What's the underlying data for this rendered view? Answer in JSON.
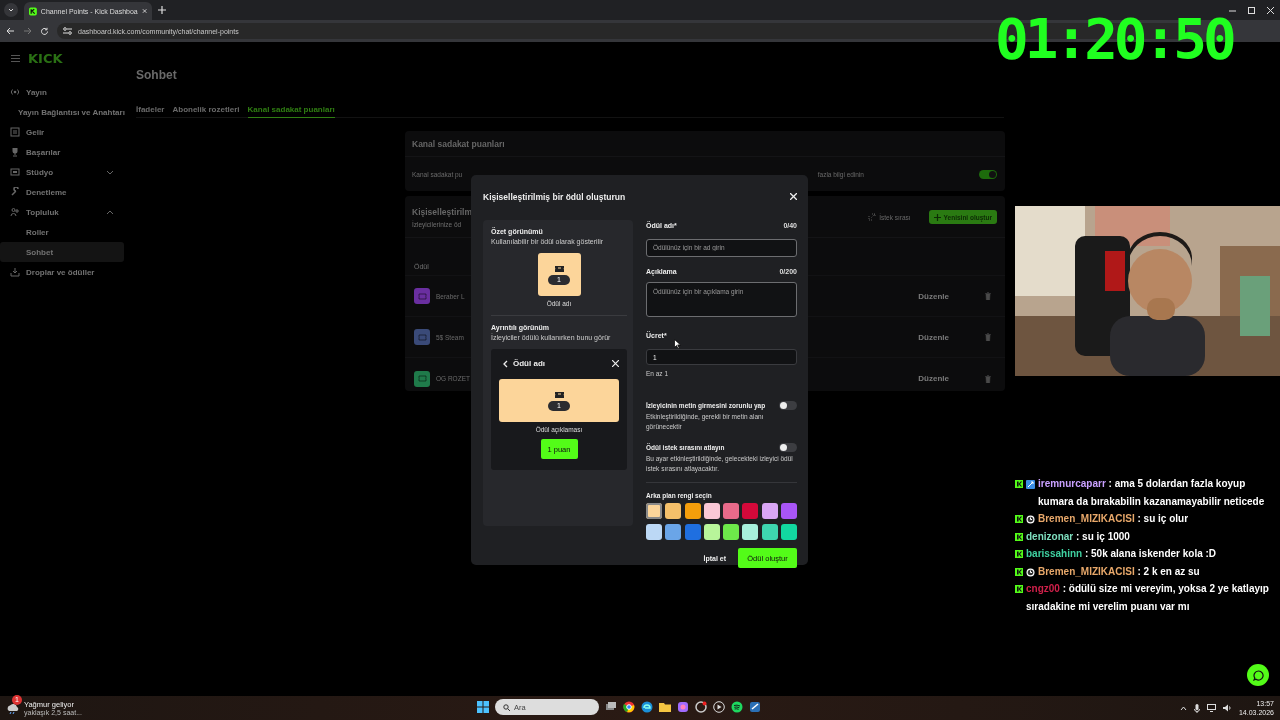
{
  "browser": {
    "tab_title": "Channel Points - Kick Dashboa",
    "url": "dashboard.kick.com/community/chat/channel-points"
  },
  "timer": "01:20:50",
  "logo": "KICK",
  "sidebar": {
    "items": [
      {
        "label": "Yayın",
        "selected": false,
        "children": [
          {
            "label": "Yayın Bağlantısı ve Anahtarı",
            "selected": false
          }
        ]
      },
      {
        "label": "Gelir",
        "selected": false
      },
      {
        "label": "Başarılar",
        "selected": false
      },
      {
        "label": "Stüdyo",
        "selected": false,
        "expanded": false
      },
      {
        "label": "Denetleme",
        "selected": false
      },
      {
        "label": "Topluluk",
        "selected": false,
        "expanded": true,
        "children": [
          {
            "label": "Roller",
            "selected": false
          },
          {
            "label": "Sohbet",
            "selected": true
          }
        ]
      },
      {
        "label": "Droplar ve ödüller",
        "selected": false
      }
    ]
  },
  "page": {
    "title": "Sohbet",
    "tabs": [
      {
        "label": "İfadeler",
        "selected": false
      },
      {
        "label": "Abonelik rozetleri",
        "selected": false
      },
      {
        "label": "Kanal sadakat puanları",
        "selected": true
      }
    ]
  },
  "points_card": {
    "title": "Kanal sadakat puanları",
    "setting_text": "Kanal sadakat pu",
    "link": "fazla bilgi edinin",
    "on": true
  },
  "rewards_card": {
    "title": "Kişiselleştirilm",
    "subtitle": "İzleyicilerinize öd",
    "queue_link": "İstek sırası",
    "new_button": "Yenisini oluştur",
    "column": "Ödül",
    "rows": [
      {
        "name": "Beraber L",
        "color": "#6a2fa0",
        "action": "Düzenle"
      },
      {
        "name": "5$ Steam",
        "color": "#3a4a78",
        "action": "Düzenle"
      },
      {
        "name": "OG ROZET",
        "color": "#1f7a4a",
        "action": "Düzenle"
      }
    ]
  },
  "modal": {
    "title": "Kişiselleştirilmiş bir ödül oluşturun",
    "summary": {
      "title": "Özet görünümü",
      "subtitle": "Kullanılabilir bir ödül olarak gösterilir",
      "cost": "1",
      "caption": "Ödül adı"
    },
    "detail": {
      "title": "Ayrıntılı görünüm",
      "subtitle": "İzleyiciler ödülü kullanırken bunu görür",
      "header": "Ödül adı",
      "cost": "1",
      "caption": "Ödül açıklaması",
      "button": "1 puan"
    },
    "fields": [
      {
        "kind": "input",
        "label": "Ödül adı*",
        "counter": "0/40",
        "placeholder": "Ödülünüz için bir ad girin"
      },
      {
        "kind": "textarea",
        "label": "Açıklama",
        "counter": "0/200",
        "placeholder": "Ödülünüz için bir açıklama girin"
      },
      {
        "kind": "input",
        "label": "Ücret*",
        "value": "1",
        "hint": "En az 1"
      }
    ],
    "toggles": [
      {
        "label": "İzleyicinin metin girmesini zorunlu yap",
        "description": "Etkinleştirildiğinde, gerekli bir metin alanı görünecektir",
        "on": false
      },
      {
        "label": "Ödül istek sırasını atlayın",
        "description": "Bu ayar etkinleştirildiğinde, gelecekteki izleyici ödül istek sırasını atlayacaktır.",
        "on": false
      }
    ],
    "colors_label": "Arka plan rengi seçin",
    "swatches": [
      {
        "color": "#fcd59a",
        "selected": true
      },
      {
        "color": "#f5c06a",
        "selected": false
      },
      {
        "color": "#f59e0b",
        "selected": false
      },
      {
        "color": "#f9c7d6",
        "selected": false
      },
      {
        "color": "#e86a8a",
        "selected": false
      },
      {
        "color": "#d4093a",
        "selected": false
      },
      {
        "color": "#d9a6f5",
        "selected": false
      },
      {
        "color": "#a855f7",
        "selected": false
      },
      {
        "color": "#bcd8f5",
        "selected": false
      },
      {
        "color": "#6aa5e8",
        "selected": false
      },
      {
        "color": "#1f6fe0",
        "selected": false
      },
      {
        "color": "#b8f59a",
        "selected": false
      },
      {
        "color": "#6de84a",
        "selected": false
      },
      {
        "color": "#a8f0dc",
        "selected": false
      },
      {
        "color": "#3ed6b0",
        "selected": false
      },
      {
        "color": "#12d8a0",
        "selected": false
      }
    ],
    "cancel": "İptal et",
    "submit": "Ödül oluştur"
  },
  "chat": [
    {
      "kind": "square",
      "user": "iremnurcaparr",
      "color": "#c9a0ff",
      "message": ": ama 5 dolardan fazla koyup kumara da bırakabilin kazanamayabilir neticede"
    },
    {
      "kind": "round",
      "user": "Bremen_MIZIKACISI",
      "color": "#e8a86a",
      "message": ": su iç olur"
    },
    {
      "kind": "plain",
      "user": "denizonar",
      "color": "#7fe0c0",
      "message": ": su iç 1000"
    },
    {
      "kind": "plain",
      "user": "barissahinn",
      "color": "#3fd0a0",
      "message": ": 50k alana iskender kola :D"
    },
    {
      "kind": "round",
      "user": "Bremen_MIZIKACISI",
      "color": "#e8a86a",
      "message": ": 2 k en az su"
    },
    {
      "kind": "plain",
      "user": "cngz00",
      "color": "#d0204a",
      "message": ": ödülü size mi vereyim, yoksa 2 ye katlayıp sıradakine mi verelim puanı var mı"
    }
  ],
  "taskbar": {
    "weather_title": "Yağmur geliyor",
    "weather_subtitle": "yaklaşık 2,5 saat...",
    "weather_badge": "1",
    "search_placeholder": "Ara",
    "time": "13:57",
    "date": "14.03.2026"
  }
}
